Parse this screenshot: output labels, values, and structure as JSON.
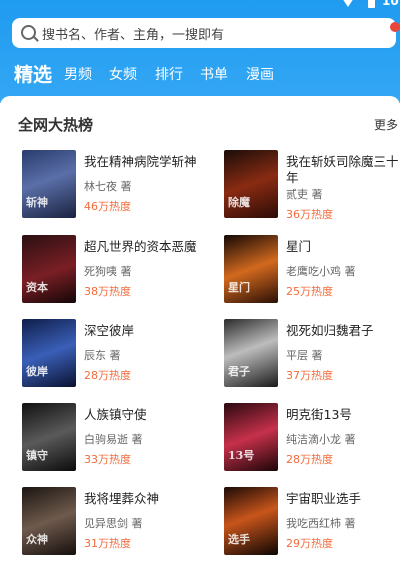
{
  "status": {
    "time": "10:"
  },
  "search": {
    "placeholder": "搜书名、作者、主角，一搜即有"
  },
  "tabs": [
    "精选",
    "男频",
    "女频",
    "排行",
    "书单",
    "漫画"
  ],
  "section": {
    "title": "全网大热榜",
    "more": "更多"
  },
  "books": [
    {
      "title": "我在精神病院学斩神",
      "author": "林七夜 著",
      "heat": "46万热度"
    },
    {
      "title": "我在斩妖司除魔三十年",
      "author": "贰吏 著",
      "heat": "36万热度"
    },
    {
      "title": "超凡世界的资本恶魔",
      "author": "死狗咦 著",
      "heat": "38万热度"
    },
    {
      "title": "星门",
      "author": "老鹰吃小鸡 著",
      "heat": "25万热度"
    },
    {
      "title": "深空彼岸",
      "author": "辰东 著",
      "heat": "28万热度"
    },
    {
      "title": "视死如归魏君子",
      "author": "平层 著",
      "heat": "37万热度"
    },
    {
      "title": "人族镇守使",
      "author": "白驹易逝 著",
      "heat": "33万热度"
    },
    {
      "title": "明克街13号",
      "author": "纯洁滴小龙 著",
      "heat": "28万热度"
    },
    {
      "title": "我将埋葬众神",
      "author": "见异思剑 著",
      "heat": "31万热度"
    },
    {
      "title": "宇宙职业选手",
      "author": "我吃西红柿 著",
      "heat": "29万热度"
    }
  ]
}
